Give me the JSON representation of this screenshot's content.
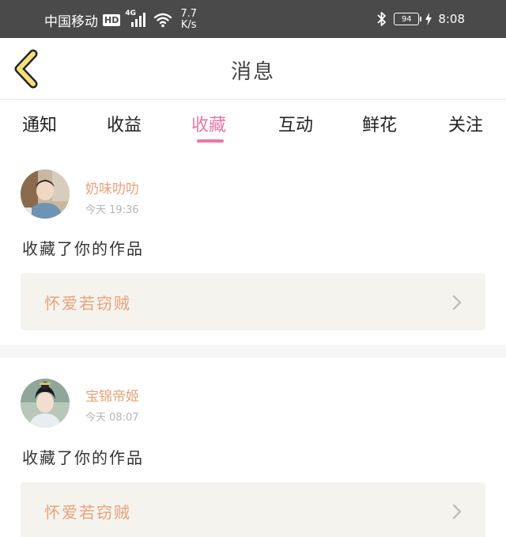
{
  "status_bar": {
    "carrier": "中国移动",
    "hd_badge": "HD",
    "network_type": "4G",
    "speed_value": "7.7",
    "speed_unit": "K/s",
    "battery_level": "94",
    "time": "8:08",
    "icons": [
      "hd-icon",
      "signal-icon",
      "wifi-icon",
      "bluetooth-icon",
      "battery-icon",
      "charging-icon"
    ]
  },
  "header": {
    "title": "消息",
    "back_icon": "chevron-left-icon"
  },
  "tabs": [
    {
      "label": "通知",
      "active": false
    },
    {
      "label": "收益",
      "active": false
    },
    {
      "label": "收藏",
      "active": true
    },
    {
      "label": "互动",
      "active": false
    },
    {
      "label": "鲜花",
      "active": false
    },
    {
      "label": "关注",
      "active": false
    }
  ],
  "messages": [
    {
      "user_name": "奶味叻叻",
      "time": "今天 19:36",
      "action": "收藏了你的作品",
      "work_title": "怀爱若窃贼"
    },
    {
      "user_name": "宝锦帝姬",
      "time": "今天 08:07",
      "action": "收藏了你的作品",
      "work_title": "怀爱若窃贼"
    }
  ],
  "colors": {
    "status_bar_bg": "#4a4a4a",
    "accent_pink": "#e978a8",
    "name_orange": "#e8a27a",
    "work_box_bg": "#f4f3ee",
    "back_icon_fill": "#f4e07a"
  }
}
